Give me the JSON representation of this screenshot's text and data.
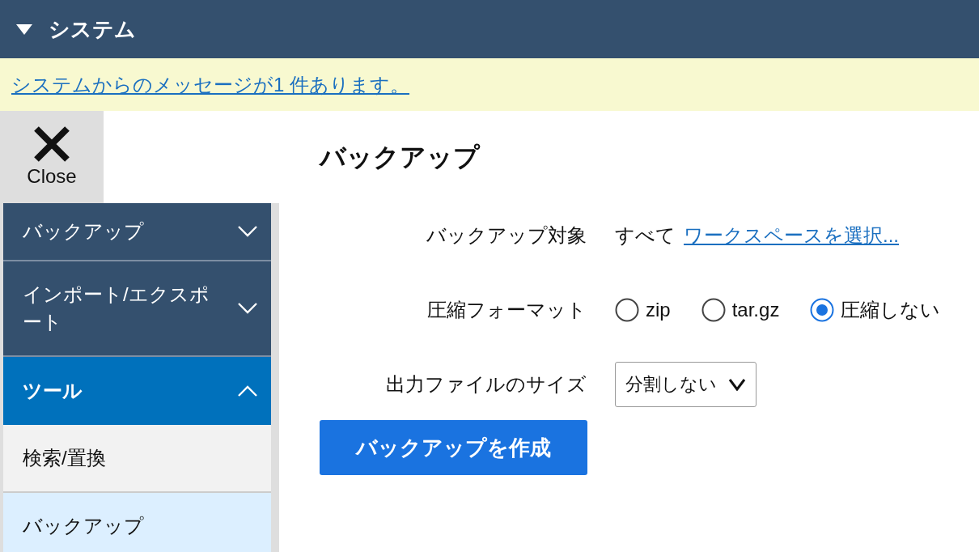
{
  "header": {
    "title": "システム",
    "expanded": true
  },
  "message": {
    "link": "システムからのメッセージが1 件あります。"
  },
  "close_button": {
    "label": "Close"
  },
  "sidebar": {
    "sections": [
      {
        "label": "バックアップ",
        "expanded": false
      },
      {
        "label": "インポート/エクスポート",
        "expanded": false
      },
      {
        "label": "ツール",
        "expanded": true,
        "children": [
          {
            "label": "検索/置換",
            "selected": false
          },
          {
            "label": "バックアップ",
            "selected": true
          }
        ]
      }
    ]
  },
  "main": {
    "title": "バックアップ",
    "fields": [
      {
        "kind": "text-link",
        "label": "バックアップ対象",
        "value": "すべて",
        "link": "ワークスペースを選択..."
      },
      {
        "kind": "radio",
        "label": "圧縮フォーマット",
        "options": [
          {
            "label": "zip",
            "selected": false
          },
          {
            "label": "tar.gz",
            "selected": false
          },
          {
            "label": "圧縮しない",
            "selected": true
          }
        ]
      },
      {
        "kind": "select",
        "label": "出力ファイルのサイズ",
        "value": "分割しない"
      }
    ],
    "button": "バックアップを作成"
  }
}
